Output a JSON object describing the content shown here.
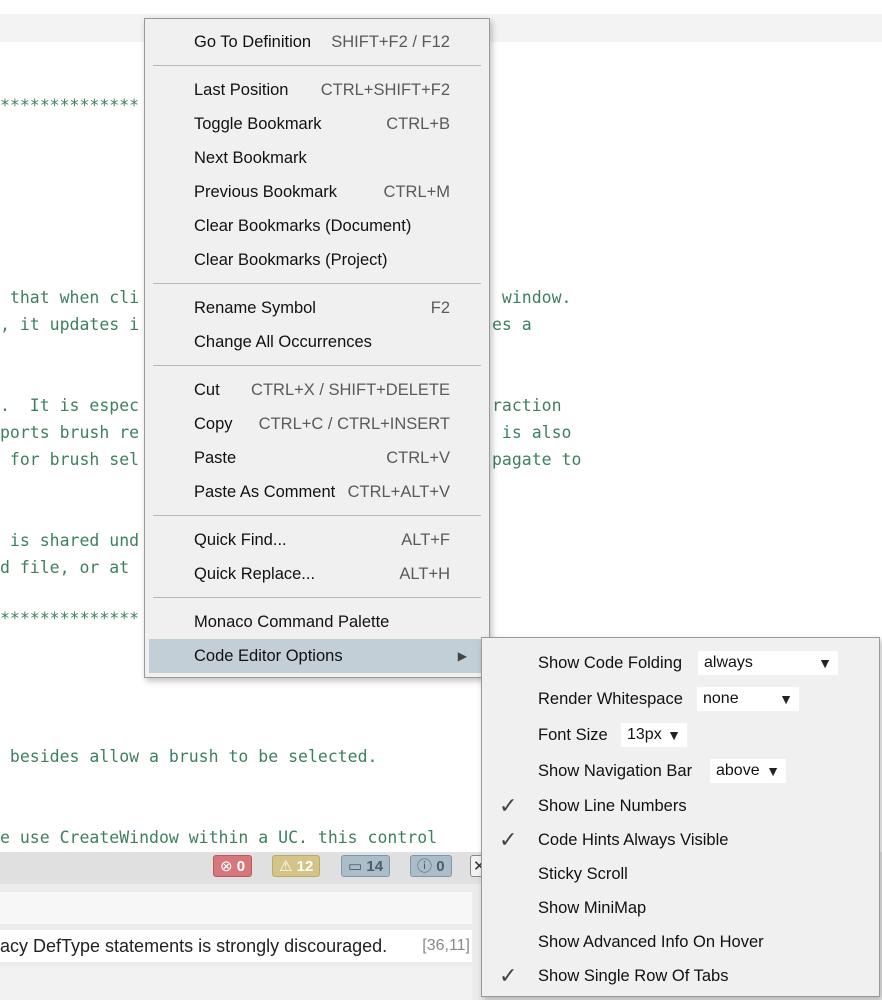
{
  "editor": {
    "lines": [
      "**************",
      " that when cli",
      ", it updates i",
      ".  It is espec",
      "ports brush re",
      " for brush sel",
      " is shared und",
      "d file, or at ",
      "**************",
      " besides allow a brush to be selected.",
      "e use CreateWindow within a UC. this control"
    ],
    "right_fragments": [
      " window.",
      "es a",
      "raction",
      " is also",
      "pagate to"
    ]
  },
  "status_badges": {
    "errors": "0",
    "warnings": "12",
    "messages": "14",
    "info": "0",
    "error_icon": "error-circle-icon",
    "warning_icon": "warning-triangle-icon",
    "message_icon": "speech-bubble-icon",
    "info_icon": "info-circle-icon"
  },
  "problems": {
    "row_text": "acy DefType statements is strongly discouraged.",
    "row_position": "[36,11]"
  },
  "context_menu": {
    "items": [
      {
        "label": "Go To Definition",
        "shortcut": "SHIFT+F2 / F12"
      },
      {
        "label": "Last Position",
        "shortcut": "CTRL+SHIFT+F2"
      },
      {
        "label": "Toggle Bookmark",
        "shortcut": "CTRL+B"
      },
      {
        "label": "Next Bookmark",
        "shortcut": ""
      },
      {
        "label": "Previous Bookmark",
        "shortcut": "CTRL+M"
      },
      {
        "label": "Clear Bookmarks (Document)",
        "shortcut": ""
      },
      {
        "label": "Clear Bookmarks (Project)",
        "shortcut": ""
      },
      {
        "label": "Rename Symbol",
        "shortcut": "F2"
      },
      {
        "label": "Change All Occurrences",
        "shortcut": ""
      },
      {
        "label": "Cut",
        "shortcut": "CTRL+X / SHIFT+DELETE"
      },
      {
        "label": "Copy",
        "shortcut": "CTRL+C / CTRL+INSERT"
      },
      {
        "label": "Paste",
        "shortcut": "CTRL+V"
      },
      {
        "label": "Paste As Comment",
        "shortcut": "CTRL+ALT+V"
      },
      {
        "label": "Quick Find...",
        "shortcut": "ALT+F"
      },
      {
        "label": "Quick Replace...",
        "shortcut": "ALT+H"
      },
      {
        "label": "Monaco Command Palette",
        "shortcut": ""
      },
      {
        "label": "Code Editor Options",
        "shortcut": ""
      }
    ]
  },
  "submenu": {
    "items": [
      {
        "label": "Show Code Folding",
        "value": "always",
        "checked": false
      },
      {
        "label": "Render Whitespace",
        "value": "none",
        "checked": false
      },
      {
        "label": "Font Size",
        "value": "13px",
        "checked": false
      },
      {
        "label": "Show Navigation Bar",
        "value": "above",
        "checked": false
      },
      {
        "label": "Show Line Numbers",
        "checked": true
      },
      {
        "label": "Code Hints Always Visible",
        "checked": true
      },
      {
        "label": "Sticky Scroll",
        "checked": false
      },
      {
        "label": "Show MiniMap",
        "checked": false
      },
      {
        "label": "Show Advanced Info On Hover",
        "checked": false
      },
      {
        "label": "Show Single Row Of Tabs",
        "checked": true
      }
    ],
    "check_glyph": "✓"
  },
  "colors": {
    "code_comment": "#3f7f5f",
    "menu_background": "#f0f0f0",
    "menu_highlight": "#c3cfd6"
  }
}
